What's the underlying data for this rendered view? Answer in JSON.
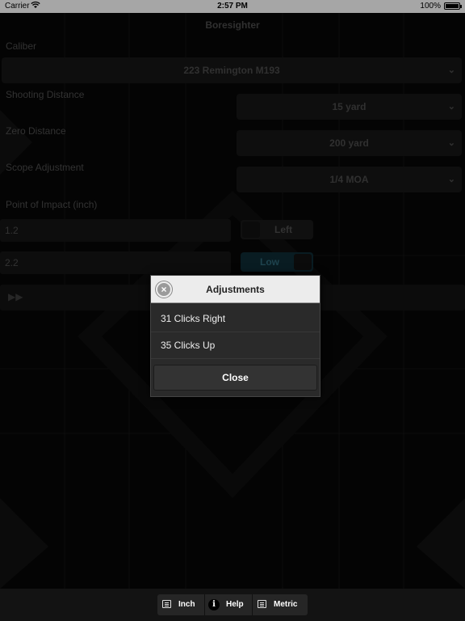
{
  "status_bar": {
    "carrier": "Carrier",
    "time": "2:57 PM",
    "battery": "100%"
  },
  "nav": {
    "title": "Boresighter"
  },
  "form": {
    "caliber_label": "Caliber",
    "caliber_value": "223 Remington M193",
    "shooting_distance_label": "Shooting Distance",
    "shooting_distance_value": "15 yard",
    "zero_distance_label": "Zero Distance",
    "zero_distance_value": "200 yard",
    "scope_adjustment_label": "Scope Adjustment",
    "scope_adjustment_value": "1/4 MOA",
    "point_of_impact_label": "Point of Impact (inch)",
    "horizontal_value": "1.2",
    "horizontal_direction": "Left",
    "vertical_value": "2.2",
    "vertical_direction": "Low"
  },
  "dialog": {
    "title": "Adjustments",
    "items": [
      "31 Clicks Right",
      "35 Clicks Up"
    ],
    "close_label": "Close"
  },
  "toolbar": {
    "inch_label": "Inch",
    "help_label": "Help",
    "metric_label": "Metric"
  },
  "icons": {
    "close": "circle-x-icon",
    "chevron": "chevron-down-icon",
    "calculate": "fast-forward-icon",
    "inch": "list-icon",
    "help": "info-icon",
    "metric": "list-icon"
  },
  "colors": {
    "background": "#0a0a0a",
    "dialog_header": "#ececec",
    "dialog_body": "#2a2a2a",
    "toggle_active": "#0f2c35"
  }
}
